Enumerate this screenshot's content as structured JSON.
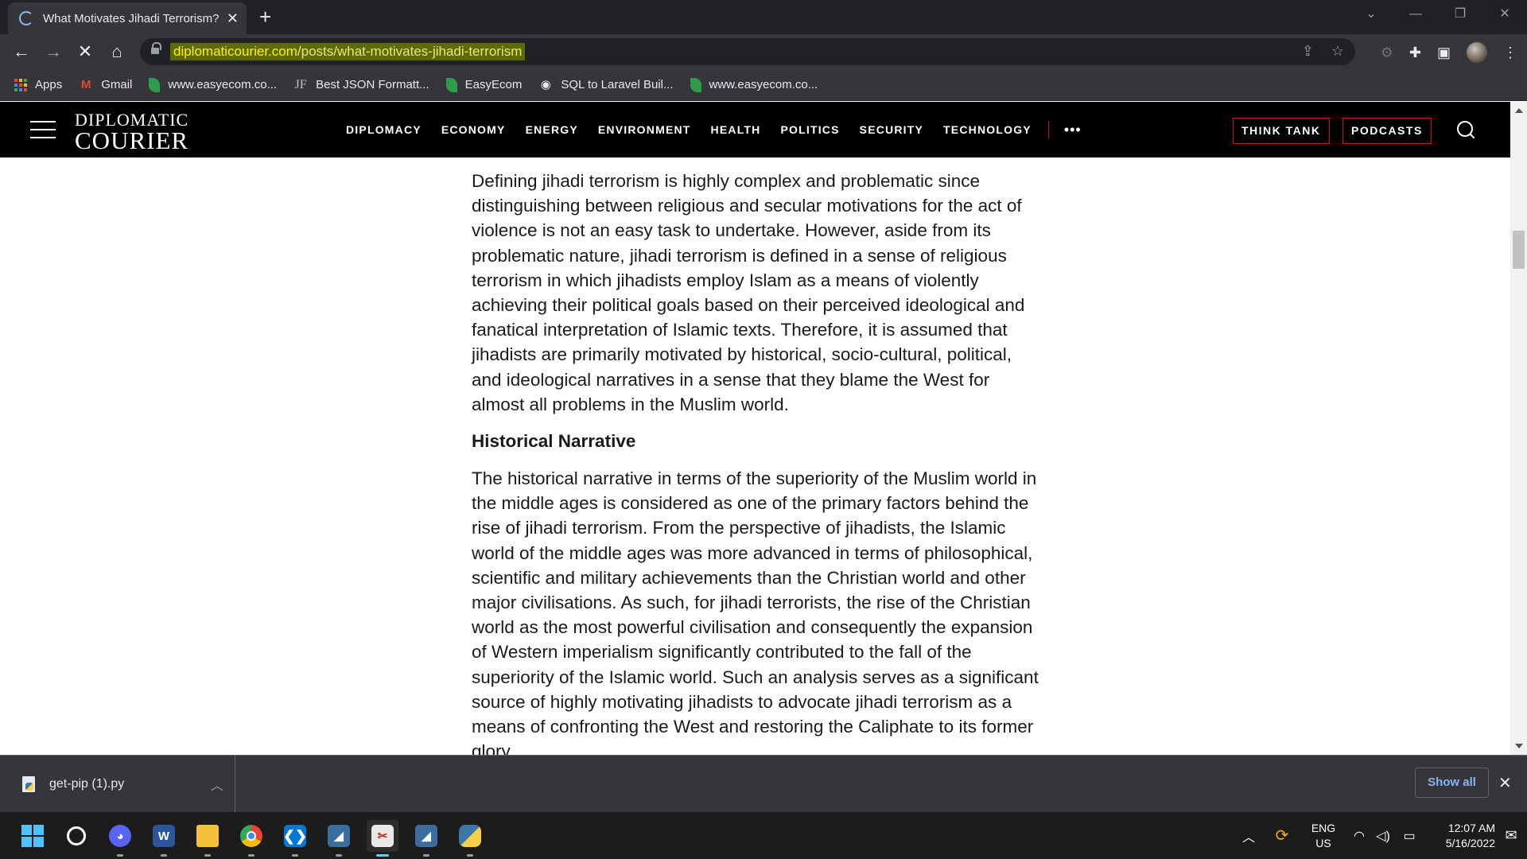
{
  "browser": {
    "tab_title": "What Motivates Jihadi Terrorism?",
    "url_domain": "diplomaticourier.com",
    "url_path": "/posts/what-motivates-jihadi-terrorism",
    "bookmarks": [
      {
        "label": "Apps",
        "icon": "apps-grid-icon"
      },
      {
        "label": "Gmail",
        "icon": "gmail-icon"
      },
      {
        "label": "www.easyecom.co...",
        "icon": "easyecom-leaf-icon"
      },
      {
        "label": "Best JSON Formatt...",
        "icon": "jf-icon"
      },
      {
        "label": "EasyEcom",
        "icon": "easyecom-leaf-icon"
      },
      {
        "label": "SQL to Laravel Buil...",
        "icon": "globe-icon"
      },
      {
        "label": "www.easyecom.co...",
        "icon": "easyecom-leaf-icon"
      }
    ]
  },
  "site": {
    "logo_line1": "DIPLOMATIC",
    "logo_line2": "COURIER",
    "nav": [
      "DIPLOMACY",
      "ECONOMY",
      "ENERGY",
      "ENVIRONMENT",
      "HEALTH",
      "POLITICS",
      "SECURITY",
      "TECHNOLOGY"
    ],
    "more": "•••",
    "think_tank": "THINK TANK",
    "podcasts": "PODCASTS",
    "accent_color": "#c8102e"
  },
  "article": {
    "para1": "Defining jihadi terrorism is highly complex and problematic since distinguishing between religious and secular motivations for the act of violence is not an easy task to undertake. However, aside from its problematic nature, jihadi terrorism is defined in a sense of religious terrorism in which jihadists employ Islam as a means of violently achieving their political goals based on their perceived ideological and fanatical interpretation of Islamic texts. Therefore, it is assumed that jihadists are primarily motivated by historical, socio-cultural, political, and ideological narratives in a sense that they blame the West for almost all problems in the Muslim world.",
    "heading": "Historical Narrative",
    "para2": "The historical narrative in terms of the superiority of the Muslim world in the middle ages is considered as one of the primary factors behind the rise of jihadi terrorism. From the perspective of jihadists, the Islamic world of the middle ages was more advanced in terms of philosophical, scientific and military achievements than the Christian world and other major civilisations. As such, for jihadi terrorists, the rise of the Christian world as the most powerful civilisation and consequently the expansion of Western imperialism significantly contributed to the fall of the superiority of the Islamic world. Such an analysis serves as a significant source of highly motivating jihadists to advocate jihadi terrorism as a means of confronting the West and restoring the Caliphate to its former glory."
  },
  "downloads": {
    "file_name": "get-pip (1).py",
    "show_all": "Show all"
  },
  "taskbar": {
    "lang_line1": "ENG",
    "lang_line2": "US",
    "time": "12:07 AM",
    "date": "5/16/2022"
  }
}
